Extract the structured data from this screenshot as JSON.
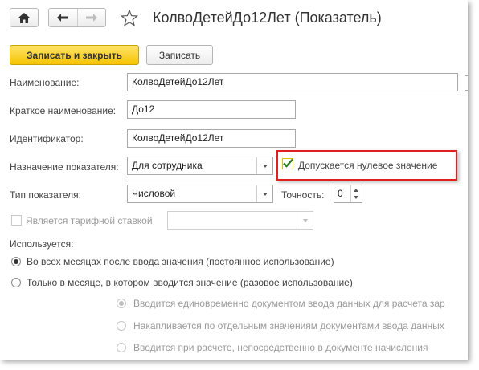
{
  "window": {
    "title": "КолвоДетейДо12Лет (Показатель)",
    "star_icon": "star-outline-icon"
  },
  "nav": {
    "home_icon": "home-icon",
    "back_icon": "arrow-left-icon",
    "forward_icon": "arrow-right-icon"
  },
  "toolbar": {
    "save_close_label": "Записать и закрыть",
    "save_label": "Записать"
  },
  "form": {
    "name": {
      "label": "Наименование:",
      "value": "КолвоДетейДо12Лет"
    },
    "short_name": {
      "label": "Краткое наименование:",
      "value": "До12"
    },
    "identifier": {
      "label": "Идентификатор:",
      "value": "КолвоДетейДо12Лет"
    },
    "purpose": {
      "label": "Назначение показателя:",
      "value": "Для сотрудника"
    },
    "allow_zero": {
      "label": "Допускается нулевое значение",
      "checked": true
    },
    "type": {
      "label": "Тип показателя:",
      "value": "Числовой"
    },
    "precision": {
      "label": "Точность:",
      "value": "0"
    },
    "tariff": {
      "label": "Является тарифной ставкой",
      "checked": false,
      "value": ""
    },
    "used_label": "Используется:",
    "usage_options": [
      {
        "label": "Во всех месяцах после ввода значения (постоянное использование)",
        "selected": true,
        "enabled": true
      },
      {
        "label": "Только в месяце, в котором вводится значение (разовое использование)",
        "selected": false,
        "enabled": true
      }
    ],
    "input_options": [
      {
        "label": "Вводится единовременно документом ввода данных для расчета зар",
        "selected": true,
        "enabled": false
      },
      {
        "label": "Накапливается по отдельным значениям документами ввода данных",
        "selected": false,
        "enabled": false
      },
      {
        "label": "Вводится при расчете, непосредственно в документе начисления",
        "selected": false,
        "enabled": false
      }
    ]
  },
  "colors": {
    "accent": "#f5c400",
    "highlight_border": "#e02020",
    "checkmark": "#2a7d1a"
  }
}
